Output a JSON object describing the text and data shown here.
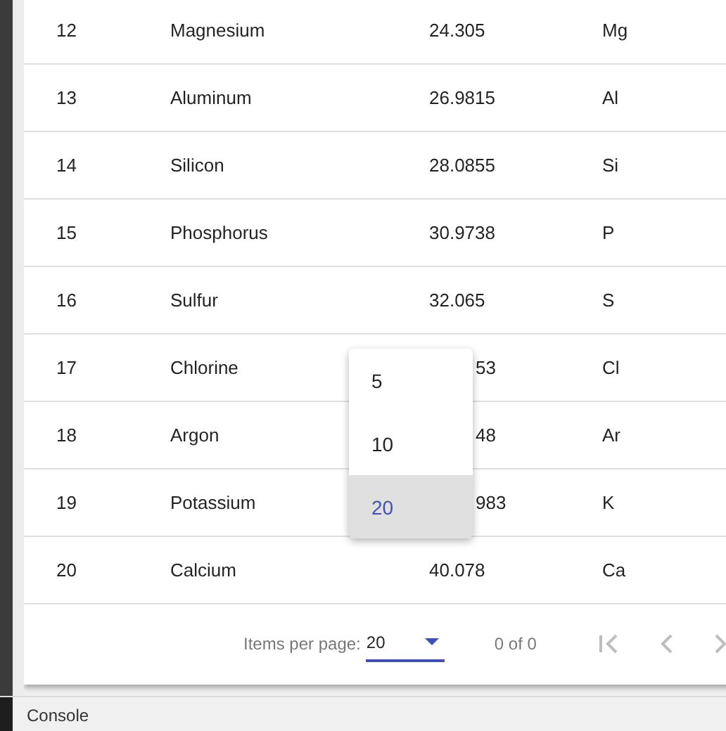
{
  "table": {
    "rows": [
      {
        "number": "12",
        "name": "Magnesium",
        "weight": "24.305",
        "symbol": "Mg",
        "covered": false
      },
      {
        "number": "13",
        "name": "Aluminum",
        "weight": "26.9815",
        "symbol": "Al",
        "covered": false
      },
      {
        "number": "14",
        "name": "Silicon",
        "weight": "28.0855",
        "symbol": "Si",
        "covered": false
      },
      {
        "number": "15",
        "name": "Phosphorus",
        "weight": "30.9738",
        "symbol": "P",
        "covered": false
      },
      {
        "number": "16",
        "name": "Sulfur",
        "weight": "32.065",
        "symbol": "S",
        "covered": false
      },
      {
        "number": "17",
        "name": "Chlorine",
        "weight": "53",
        "symbol": "Cl",
        "covered": true
      },
      {
        "number": "18",
        "name": "Argon",
        "weight": "48",
        "symbol": "Ar",
        "covered": true
      },
      {
        "number": "19",
        "name": "Potassium",
        "weight": "983",
        "symbol": "K",
        "covered": true
      },
      {
        "number": "20",
        "name": "Calcium",
        "weight": "40.078",
        "symbol": "Ca",
        "covered": false
      }
    ]
  },
  "paginator": {
    "label": "Items per page:",
    "page_size": "20",
    "range": "0 of 0"
  },
  "page_size_menu": {
    "options": [
      {
        "label": "5",
        "selected": false
      },
      {
        "label": "10",
        "selected": false
      },
      {
        "label": "20",
        "selected": true
      }
    ]
  },
  "console_bar": {
    "label": "Console"
  }
}
